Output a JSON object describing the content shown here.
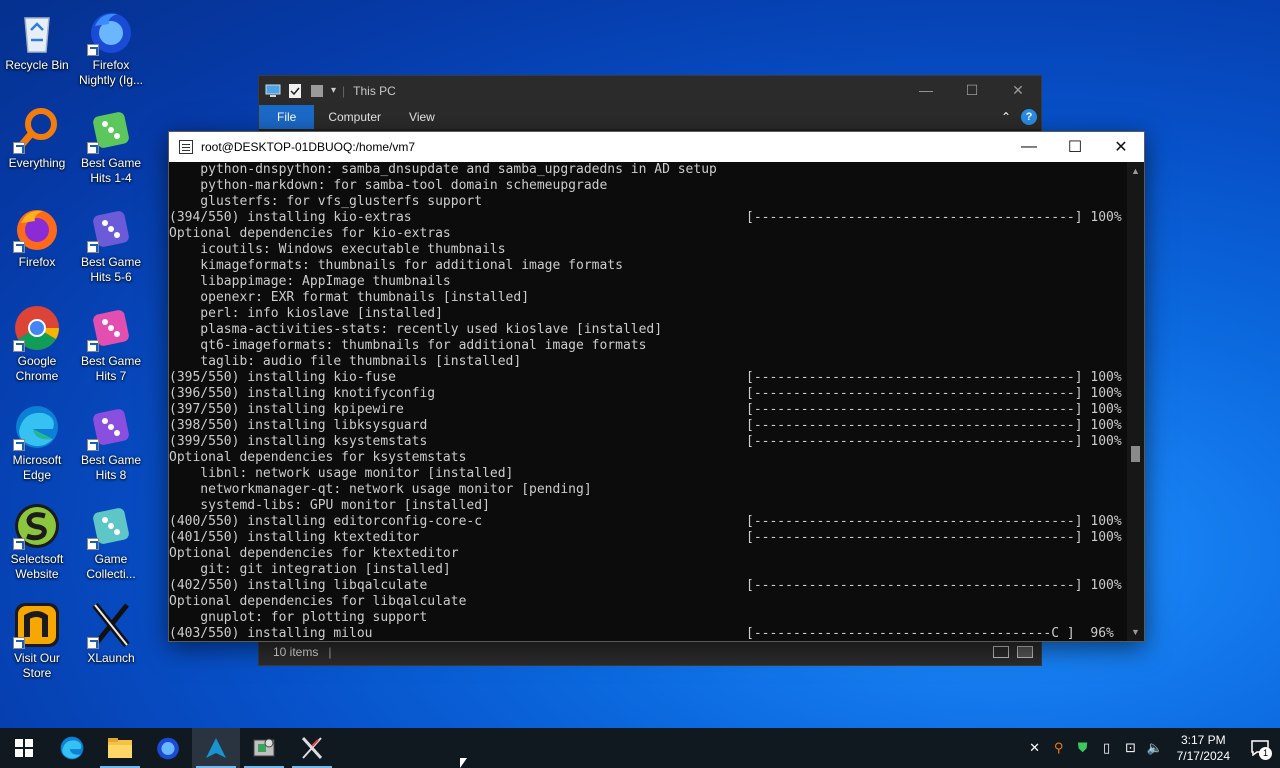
{
  "desktop": {
    "icons": [
      {
        "label": "Recycle Bin",
        "icon": "recycle-bin-icon"
      },
      {
        "label": "Firefox Nightly (Ig...",
        "icon": "firefox-nightly-icon"
      },
      {
        "label": "Everything",
        "icon": "everything-search-icon"
      },
      {
        "label": "Best Game Hits 1-4",
        "icon": "dice-icon"
      },
      {
        "label": "Firefox",
        "icon": "firefox-icon"
      },
      {
        "label": "Best Game Hits 5-6",
        "icon": "dice-icon"
      },
      {
        "label": "Google Chrome",
        "icon": "chrome-icon"
      },
      {
        "label": "Best Game Hits 7",
        "icon": "dice-icon"
      },
      {
        "label": "Microsoft Edge",
        "icon": "edge-icon"
      },
      {
        "label": "Best Game Hits 8",
        "icon": "dice-icon"
      },
      {
        "label": "Selectsoft Website",
        "icon": "selectsoft-icon"
      },
      {
        "label": "Game Collecti...",
        "icon": "dice-icon"
      },
      {
        "label": "Visit Our Store",
        "icon": "store-icon"
      },
      {
        "label": "XLaunch",
        "icon": "xlaunch-icon"
      }
    ]
  },
  "explorer": {
    "title": "This PC",
    "tabs": [
      "File",
      "Computer",
      "View"
    ],
    "status": "10 items",
    "status_sep": "|"
  },
  "terminal": {
    "title": "root@DESKTOP-01DBUOQ:/home/vm7",
    "lines": [
      {
        "text": "    python-dnspython: samba_dnsupdate and samba_upgradedns in AD setup",
        "bar": ""
      },
      {
        "text": "    python-markdown: for samba-tool domain schemeupgrade",
        "bar": ""
      },
      {
        "text": "    glusterfs: for vfs_glusterfs support",
        "bar": ""
      },
      {
        "text": "(394/550) installing kio-extras",
        "bar": "[-----------------------------------------] 100%"
      },
      {
        "text": "Optional dependencies for kio-extras",
        "bar": ""
      },
      {
        "text": "    icoutils: Windows executable thumbnails",
        "bar": ""
      },
      {
        "text": "    kimageformats: thumbnails for additional image formats",
        "bar": ""
      },
      {
        "text": "    libappimage: AppImage thumbnails",
        "bar": ""
      },
      {
        "text": "    openexr: EXR format thumbnails [installed]",
        "bar": ""
      },
      {
        "text": "    perl: info kioslave [installed]",
        "bar": ""
      },
      {
        "text": "    plasma-activities-stats: recently used kioslave [installed]",
        "bar": ""
      },
      {
        "text": "    qt6-imageformats: thumbnails for additional image formats",
        "bar": ""
      },
      {
        "text": "    taglib: audio file thumbnails [installed]",
        "bar": ""
      },
      {
        "text": "(395/550) installing kio-fuse",
        "bar": "[-----------------------------------------] 100%"
      },
      {
        "text": "(396/550) installing knotifyconfig",
        "bar": "[-----------------------------------------] 100%"
      },
      {
        "text": "(397/550) installing kpipewire",
        "bar": "[-----------------------------------------] 100%"
      },
      {
        "text": "(398/550) installing libksysguard",
        "bar": "[-----------------------------------------] 100%"
      },
      {
        "text": "(399/550) installing ksystemstats",
        "bar": "[-----------------------------------------] 100%"
      },
      {
        "text": "Optional dependencies for ksystemstats",
        "bar": ""
      },
      {
        "text": "    libnl: network usage monitor [installed]",
        "bar": ""
      },
      {
        "text": "    networkmanager-qt: network usage monitor [pending]",
        "bar": ""
      },
      {
        "text": "    systemd-libs: GPU monitor [installed]",
        "bar": ""
      },
      {
        "text": "(400/550) installing editorconfig-core-c",
        "bar": "[-----------------------------------------] 100%"
      },
      {
        "text": "(401/550) installing ktexteditor",
        "bar": "[-----------------------------------------] 100%"
      },
      {
        "text": "Optional dependencies for ktexteditor",
        "bar": ""
      },
      {
        "text": "    git: git integration [installed]",
        "bar": ""
      },
      {
        "text": "(402/550) installing libqalculate",
        "bar": "[-----------------------------------------] 100%"
      },
      {
        "text": "Optional dependencies for libqalculate",
        "bar": ""
      },
      {
        "text": "    gnuplot: for plotting support",
        "bar": ""
      },
      {
        "text": "(403/550) installing milou",
        "bar": "[--------------------------------------C ]  96%"
      }
    ]
  },
  "taskbar": {
    "apps": [
      "start-icon",
      "edge-icon",
      "file-explorer-icon",
      "firefox-icon",
      "arch-terminal-icon",
      "app-installer-icon",
      "xlaunch-icon"
    ],
    "clock_time": "3:17 PM",
    "clock_date": "7/17/2024",
    "notification_count": "1"
  }
}
